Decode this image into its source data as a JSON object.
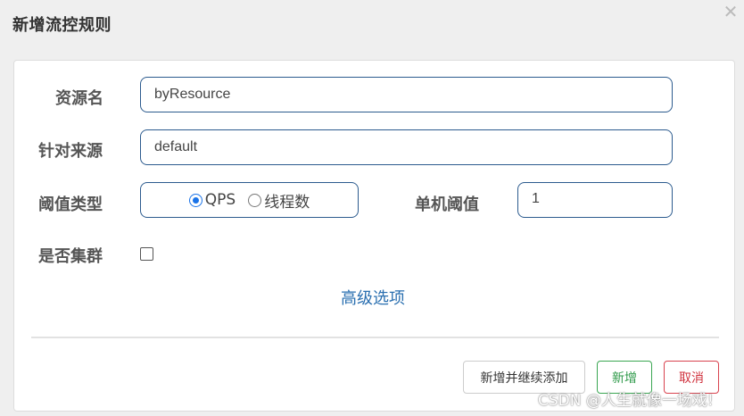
{
  "dialog": {
    "title": "新增流控规则",
    "close_glyph": "✕"
  },
  "form": {
    "resource": {
      "label": "资源名",
      "value": "byResource"
    },
    "source": {
      "label": "针对来源",
      "value": "default"
    },
    "threshold_type": {
      "label": "阈值类型",
      "options": [
        {
          "label": "QPS",
          "checked": true
        },
        {
          "label": "线程数",
          "checked": false
        }
      ]
    },
    "single_threshold": {
      "label": "单机阈值",
      "value": "1"
    },
    "cluster": {
      "label": "是否集群",
      "checked": false
    },
    "advanced_link": "高级选项"
  },
  "footer": {
    "continue_label": "新增并继续添加",
    "add_label": "新增",
    "cancel_label": "取消"
  },
  "watermark": "CSDN @人生就像一场戏!",
  "colors": {
    "input_border": "#2c5b8e",
    "link": "#2a6fb0",
    "add_button": "#3aa652",
    "cancel_button": "#d9434f",
    "radio_checked": "#1a73e8"
  }
}
